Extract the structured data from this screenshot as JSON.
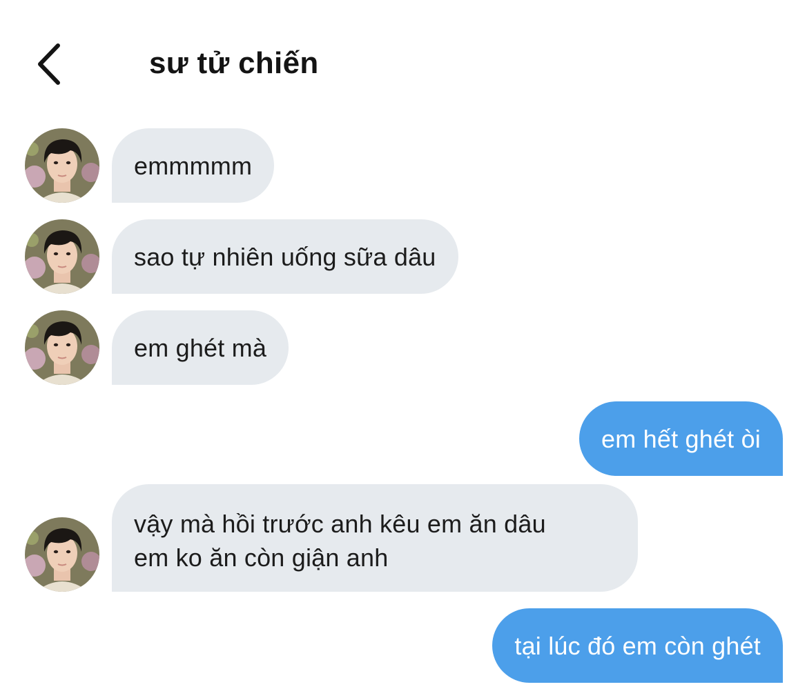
{
  "header": {
    "back_icon": "chevron-left-icon",
    "title": "sư tử chiến"
  },
  "messages": [
    {
      "direction": "incoming",
      "text": "emmmmm"
    },
    {
      "direction": "incoming",
      "text": "sao tự nhiên uống sữa dâu"
    },
    {
      "direction": "incoming",
      "text": "em ghét mà"
    },
    {
      "direction": "outgoing",
      "text": "em hết ghét òi"
    },
    {
      "direction": "incoming",
      "text": "vậy mà hồi trước anh kêu em ăn dâu\nem ko ăn còn giận anh"
    },
    {
      "direction": "outgoing",
      "text": "tại lúc đó em còn ghét"
    }
  ],
  "colors": {
    "incoming_bubble": "#e6eaee",
    "outgoing_bubble": "#4c9fea",
    "incoming_text": "#1c1c1c",
    "outgoing_text": "#ffffff",
    "title": "#141414"
  }
}
